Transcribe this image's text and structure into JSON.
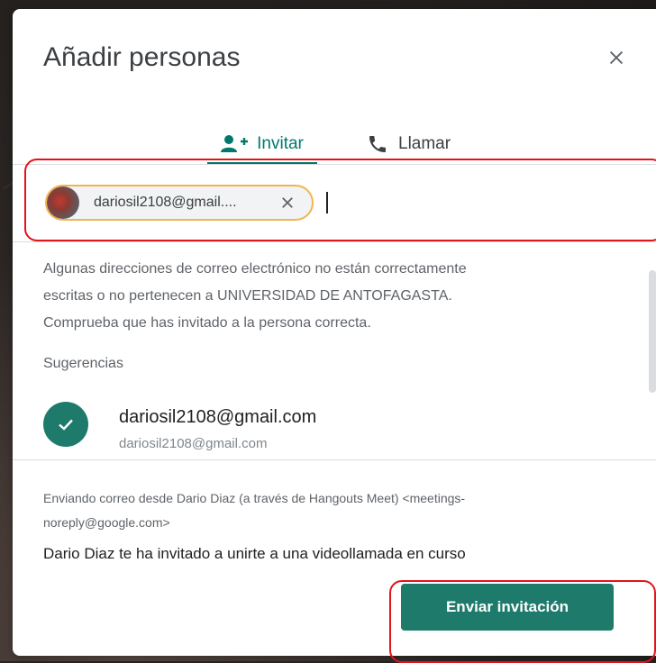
{
  "dialog": {
    "title": "Añadir personas",
    "close_icon": "close-icon"
  },
  "tabs": [
    {
      "label": "Invitar",
      "icon": "person-add-icon",
      "active": true
    },
    {
      "label": "Llamar",
      "icon": "phone-icon",
      "active": false
    }
  ],
  "recipient": {
    "chip_text": "dariosil2108@gmail....",
    "remove_icon": "close-icon"
  },
  "warning": {
    "line1": "Algunas direcciones de correo electrónico no están correctamente",
    "line2": "escritas o no pertenecen a UNIVERSIDAD DE ANTOFAGASTA.",
    "line3": "Comprueba que has invitado a la persona correcta."
  },
  "suggestions": {
    "header": "Sugerencias",
    "items": [
      {
        "name": "dariosil2108@gmail.com",
        "email": "dariosil2108@gmail.com",
        "icon": "check-icon"
      }
    ]
  },
  "footer": {
    "sender_line1": "Enviando correo desde Dario Diaz (a través de Hangouts Meet) <meetings-",
    "sender_line2": "noreply@google.com>",
    "message": "Dario Diaz te ha invitado a unirte a una videollamada en curso",
    "send_label": "Enviar invitación"
  },
  "colors": {
    "accent": "#1e7b6b",
    "highlight": "#e0141c",
    "chip_border": "#f0b550"
  }
}
